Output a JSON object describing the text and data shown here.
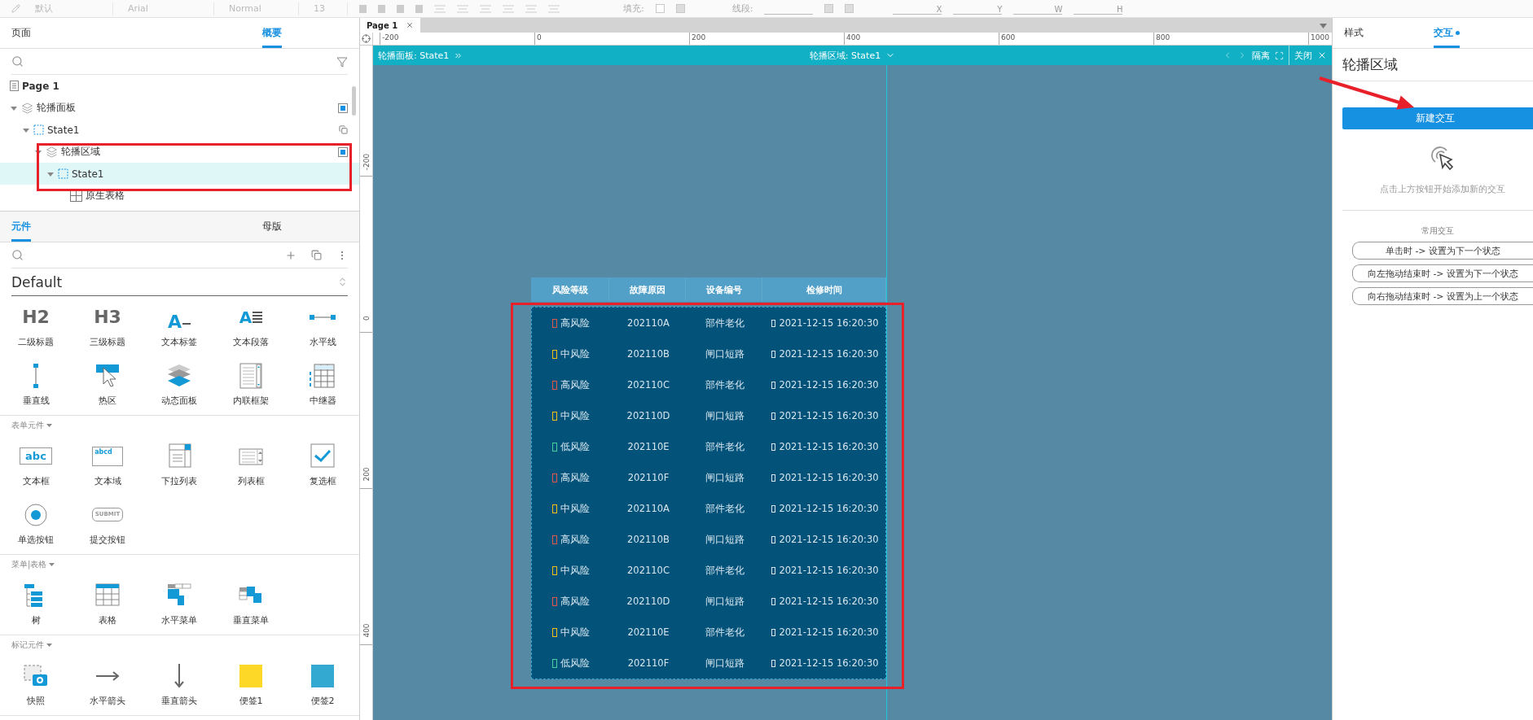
{
  "toolbar": {
    "style": "默认",
    "font": "Arial",
    "weight": "Normal",
    "size": "13",
    "fill_label": "填充:",
    "line_label": "线段:",
    "fields": [
      "X",
      "Y",
      "W",
      "H"
    ]
  },
  "outline": {
    "tabs": [
      {
        "label": "页面",
        "selected": false
      },
      {
        "label": "概要",
        "selected": true
      }
    ],
    "page": "Page 1",
    "tree": [
      {
        "label": "轮播面板",
        "kind": "panel",
        "expanded": true,
        "selected": false,
        "children": [
          {
            "label": "State1",
            "kind": "state",
            "expanded": true,
            "selected": false,
            "children": [
              {
                "label": "轮播区域",
                "kind": "panel",
                "expanded": true,
                "selected": false,
                "children": [
                  {
                    "label": "State1",
                    "kind": "state",
                    "expanded": true,
                    "selected": true,
                    "children": [
                      {
                        "label": "原生表格",
                        "kind": "table",
                        "selected": false
                      }
                    ]
                  }
                ]
              }
            ]
          }
        ]
      }
    ]
  },
  "library": {
    "tabs": [
      {
        "label": "元件",
        "selected": true
      },
      {
        "label": "母版",
        "selected": false
      }
    ],
    "name": "Default",
    "sections": [
      {
        "items": [
          {
            "label": "二级标题",
            "kind": "heading",
            "glyph": "H2"
          },
          {
            "label": "三级标题",
            "kind": "heading",
            "glyph": "H3"
          },
          {
            "label": "文本标签",
            "kind": "label",
            "glyph": "A"
          },
          {
            "label": "文本段落",
            "kind": "paragraph",
            "glyph": "A"
          },
          {
            "label": "水平线",
            "kind": "hline"
          },
          {
            "label": "垂直线",
            "kind": "vline"
          },
          {
            "label": "热区",
            "kind": "hotspot"
          },
          {
            "label": "动态面板",
            "kind": "dynpanel"
          },
          {
            "label": "内联框架",
            "kind": "iframe"
          },
          {
            "label": "中继器",
            "kind": "repeater"
          }
        ]
      },
      {
        "title": "表单元件",
        "items": [
          {
            "label": "文本框",
            "kind": "textbox",
            "glyph": "abc"
          },
          {
            "label": "文本域",
            "kind": "textarea",
            "glyph": "abcd"
          },
          {
            "label": "下拉列表",
            "kind": "droplist"
          },
          {
            "label": "列表框",
            "kind": "listbox"
          },
          {
            "label": "复选框",
            "kind": "checkbox"
          },
          {
            "label": "单选按钮",
            "kind": "radio"
          },
          {
            "label": "提交按钮",
            "kind": "submit",
            "glyph": "SUBMIT"
          }
        ]
      },
      {
        "title": "菜单|表格",
        "items": [
          {
            "label": "树",
            "kind": "tree"
          },
          {
            "label": "表格",
            "kind": "table"
          },
          {
            "label": "水平菜单",
            "kind": "hmenu"
          },
          {
            "label": "垂直菜单",
            "kind": "vmenu"
          }
        ]
      },
      {
        "title": "标记元件",
        "items": [
          {
            "label": "快照",
            "kind": "snapshot"
          },
          {
            "label": "水平箭头",
            "kind": "harrow"
          },
          {
            "label": "垂直箭头",
            "kind": "varrow"
          },
          {
            "label": "便签1",
            "kind": "note",
            "color": "#fdd826"
          },
          {
            "label": "便签2",
            "kind": "note",
            "color": "#33a8d1"
          }
        ]
      }
    ]
  },
  "canvas": {
    "page_tab": "Page 1",
    "x_ruler": [
      "-200",
      "0",
      "200",
      "400",
      "600",
      "800",
      "1000"
    ],
    "y_ruler": [
      "-200",
      "0",
      "200",
      "400"
    ],
    "banner": {
      "path": "轮播面板: State1",
      "current": "轮播区域: State1",
      "isolate": "隔离",
      "close": "关闭"
    },
    "table": {
      "columns": [
        "风险等级",
        "故障原因",
        "设备编号",
        "检修时间"
      ],
      "rows": [
        {
          "level": "高风险",
          "code": "202110A",
          "cause": "部件老化",
          "time": "2021-12-15 16:20:30",
          "color": "#e0584a"
        },
        {
          "level": "中风险",
          "code": "202110B",
          "cause": "闸口短路",
          "time": "2021-12-15 16:20:30",
          "color": "#f2c014"
        },
        {
          "level": "高风险",
          "code": "202110C",
          "cause": "部件老化",
          "time": "2021-12-15 16:20:30",
          "color": "#e0584a"
        },
        {
          "level": "中风险",
          "code": "202110D",
          "cause": "闸口短路",
          "time": "2021-12-15 16:20:30",
          "color": "#f2c014"
        },
        {
          "level": "低风险",
          "code": "202110E",
          "cause": "部件老化",
          "time": "2021-12-15 16:20:30",
          "color": "#43d1a0"
        },
        {
          "level": "高风险",
          "code": "202110F",
          "cause": "闸口短路",
          "time": "2021-12-15 16:20:30",
          "color": "#e0584a"
        },
        {
          "level": "中风险",
          "code": "202110A",
          "cause": "部件老化",
          "time": "2021-12-15 16:20:30",
          "color": "#f2c014"
        },
        {
          "level": "高风险",
          "code": "202110B",
          "cause": "闸口短路",
          "time": "2021-12-15 16:20:30",
          "color": "#e0584a"
        },
        {
          "level": "中风险",
          "code": "202110C",
          "cause": "部件老化",
          "time": "2021-12-15 16:20:30",
          "color": "#f2c014"
        },
        {
          "level": "高风险",
          "code": "202110D",
          "cause": "闸口短路",
          "time": "2021-12-15 16:20:30",
          "color": "#e0584a"
        },
        {
          "level": "中风险",
          "code": "202110E",
          "cause": "部件老化",
          "time": "2021-12-15 16:20:30",
          "color": "#f2c014"
        },
        {
          "level": "低风险",
          "code": "202110F",
          "cause": "闸口短路",
          "time": "2021-12-15 16:20:30",
          "color": "#43d1a0"
        }
      ]
    }
  },
  "inspector": {
    "tabs": [
      {
        "label": "样式",
        "selected": false,
        "has_items": false
      },
      {
        "label": "交互",
        "selected": true,
        "has_items": true
      }
    ],
    "title": "轮播区域",
    "new_button": "新建交互",
    "hint": "点击上方按钮开始添加新的交互",
    "common_title": "常用交互",
    "common_actions": [
      "单击时 -> 设置为下一个状态",
      "向左拖动结束时 -> 设置为下一个状态",
      "向右拖动结束时 -> 设置为上一个状态"
    ]
  }
}
